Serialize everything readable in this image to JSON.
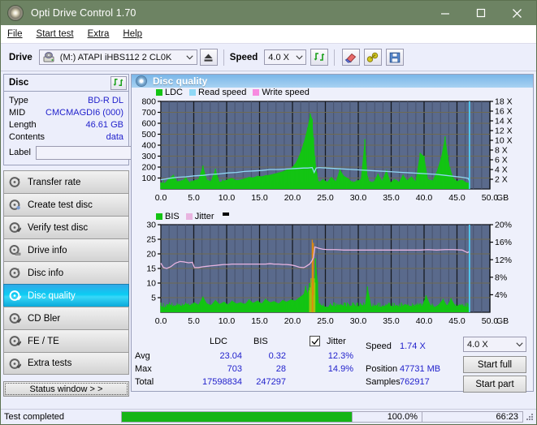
{
  "window": {
    "title": "Opti Drive Control 1.70",
    "icon": "disc-icon",
    "minimize": "minimize-icon",
    "maximize": "maximize-icon",
    "close": "close-icon"
  },
  "menu": {
    "items": [
      {
        "label": "File"
      },
      {
        "label": "Start test"
      },
      {
        "label": "Extra"
      },
      {
        "label": "Help"
      }
    ]
  },
  "toolbar": {
    "drive_label": "Drive",
    "drive_value": "(M:)   ATAPI iHBS112  2 CL0K",
    "eject_icon": "eject-icon",
    "speed_label": "Speed",
    "speed_value": "4.0 X",
    "refresh_icon": "refresh-icon",
    "eraser_icon": "eraser-icon",
    "key_icon": "key-icon",
    "save_icon": "floppy-save-icon"
  },
  "disc": {
    "panel_title": "Disc",
    "refresh_icon": "refresh-icon",
    "rows": [
      {
        "key": "Type",
        "value": "BD-R DL"
      },
      {
        "key": "MID",
        "value": "CMCMAGDI6 (000)"
      },
      {
        "key": "Length",
        "value": "46.61 GB"
      },
      {
        "key": "Contents",
        "value": "data"
      }
    ],
    "label_key": "Label",
    "label_value": "",
    "label_placeholder": "",
    "disc_button_icon": "disc-icon"
  },
  "sidebar": {
    "items": [
      {
        "label": "Transfer rate",
        "icon": "disc-test-icon",
        "selected": false
      },
      {
        "label": "Create test disc",
        "icon": "disc-write-icon",
        "selected": false
      },
      {
        "label": "Verify test disc",
        "icon": "disc-verify-icon",
        "selected": false
      },
      {
        "label": "Drive info",
        "icon": "drive-info-icon",
        "selected": false
      },
      {
        "label": "Disc info",
        "icon": "disc-info-icon",
        "selected": false
      },
      {
        "label": "Disc quality",
        "icon": "disc-quality-icon",
        "selected": true
      },
      {
        "label": "CD Bler",
        "icon": "cd-bler-icon",
        "selected": false
      },
      {
        "label": "FE / TE",
        "icon": "fete-icon",
        "selected": false
      },
      {
        "label": "Extra tests",
        "icon": "extra-tests-icon",
        "selected": false
      }
    ],
    "status_window_button": "Status window > >"
  },
  "content": {
    "header_title": "Disc quality",
    "header_icon": "disc-quality-icon"
  },
  "chart_data": [
    {
      "type": "area",
      "title": "Disc quality - LDC",
      "xlabel": "GB",
      "ylabel": "",
      "xlim": [
        0.0,
        50.0
      ],
      "xticks": [
        "0.0",
        "5.0",
        "10.0",
        "15.0",
        "20.0",
        "25.0",
        "30.0",
        "35.0",
        "40.0",
        "45.0",
        "50.0"
      ],
      "x_unit": "GB",
      "ylim": [
        0,
        800
      ],
      "yticks": [
        100,
        200,
        300,
        400,
        500,
        600,
        700,
        800
      ],
      "y2lim": [
        0,
        18
      ],
      "y2ticks": [
        "2 X",
        "4 X",
        "6 X",
        "8 X",
        "10 X",
        "12 X",
        "14 X",
        "16 X",
        "18 X"
      ],
      "grid": true,
      "legend_position": "top-left",
      "legend": [
        {
          "name": "LDC",
          "color": "#13c413"
        },
        {
          "name": "Read speed",
          "color": "#8fd8f5"
        },
        {
          "name": "Write speed",
          "color": "#f78ae0"
        }
      ],
      "series": [
        {
          "name": "LDC",
          "color": "#13c413",
          "type": "area",
          "x": [
            0.0,
            0.6,
            1.2,
            1.9,
            2.5,
            3.2,
            3.8,
            4.4,
            5.1,
            5.7,
            6.4,
            7.0,
            7.6,
            8.3,
            8.9,
            9.6,
            10.2,
            10.8,
            11.5,
            12.1,
            12.7,
            13.4,
            14.0,
            14.7,
            15.3,
            15.9,
            16.6,
            17.2,
            17.9,
            18.5,
            19.1,
            19.8,
            20.4,
            21.0,
            21.7,
            22.3,
            22.7,
            23.0,
            23.2,
            23.4,
            23.7,
            24.0,
            24.6,
            25.3,
            25.9,
            26.6,
            27.2,
            27.8,
            28.5,
            29.1,
            29.8,
            30.4,
            31.0,
            31.4,
            31.7,
            32.3,
            33.0,
            33.6,
            34.3,
            34.9,
            35.5,
            36.2,
            36.8,
            37.4,
            38.1,
            38.7,
            39.4,
            40.0,
            40.6,
            41.3,
            41.9,
            42.6,
            43.2,
            43.6,
            43.9,
            44.5,
            45.1,
            45.8,
            46.4,
            46.9
          ],
          "y": [
            60,
            55,
            95,
            130,
            70,
            75,
            105,
            60,
            80,
            90,
            215,
            85,
            70,
            185,
            65,
            75,
            90,
            100,
            80,
            85,
            95,
            110,
            105,
            120,
            115,
            125,
            130,
            140,
            150,
            160,
            175,
            190,
            230,
            300,
            420,
            560,
            690,
            640,
            470,
            300,
            150,
            60,
            90,
            65,
            110,
            70,
            180,
            120,
            95,
            60,
            75,
            90,
            455,
            120,
            70,
            60,
            140,
            75,
            175,
            60,
            90,
            65,
            130,
            80,
            115,
            70,
            330,
            300,
            90,
            75,
            155,
            290,
            480,
            310,
            200,
            95,
            70,
            85,
            60,
            55
          ]
        },
        {
          "name": "Read speed",
          "color": "#8fd8f5",
          "type": "line",
          "x": [
            0.0,
            1.3,
            2.5,
            3.8,
            5.1,
            6.4,
            7.6,
            8.9,
            10.2,
            11.5,
            12.7,
            14.0,
            15.3,
            16.6,
            17.9,
            19.1,
            20.4,
            21.7,
            22.3,
            23.0,
            23.3,
            23.6,
            24.0,
            25.3,
            26.6,
            27.8,
            29.1,
            30.4,
            31.7,
            33.0,
            34.3,
            35.5,
            36.8,
            38.1,
            39.4,
            40.6,
            41.9,
            43.2,
            44.5,
            45.8,
            46.7,
            46.9
          ],
          "y_speed": [
            1.9,
            2.2,
            2.4,
            2.5,
            2.7,
            2.8,
            3.0,
            3.1,
            3.3,
            3.4,
            3.6,
            3.7,
            3.8,
            4.0,
            4.0,
            4.1,
            4.2,
            4.3,
            4.3,
            4.4,
            3.4,
            4.3,
            4.4,
            4.3,
            4.2,
            4.1,
            4.0,
            3.9,
            3.8,
            3.7,
            3.6,
            3.5,
            3.4,
            3.3,
            3.2,
            3.1,
            3.0,
            2.8,
            2.6,
            2.4,
            2.2,
            1.6
          ]
        },
        {
          "name": "Write speed",
          "color": "#f78ae0",
          "type": "line",
          "x": [],
          "y": []
        }
      ],
      "markers": [
        {
          "name": "end-of-data-cursor",
          "x": 46.9,
          "color": "#4fd8ff"
        }
      ]
    },
    {
      "type": "area",
      "title": "Disc quality - BIS / Jitter",
      "xlabel": "GB",
      "ylabel": "",
      "xlim": [
        0.0,
        50.0
      ],
      "xticks": [
        "0.0",
        "5.0",
        "10.0",
        "15.0",
        "20.0",
        "25.0",
        "30.0",
        "35.0",
        "40.0",
        "45.0",
        "50.0"
      ],
      "x_unit": "GB",
      "ylim": [
        0,
        30
      ],
      "yticks": [
        5,
        10,
        15,
        20,
        25,
        30
      ],
      "y2lim": [
        0,
        20
      ],
      "y2ticks": [
        "4%",
        "8%",
        "12%",
        "16%",
        "20%"
      ],
      "grid": true,
      "legend_position": "top-left",
      "legend": [
        {
          "name": "BIS",
          "color": "#13c413"
        },
        {
          "name": "Jitter",
          "color": "#e8b4e0"
        },
        {
          "name": "marker",
          "color": "#000000"
        }
      ],
      "series": [
        {
          "name": "BIS",
          "color": "#13c413",
          "type": "area",
          "x": [
            0.0,
            0.6,
            1.3,
            1.9,
            2.5,
            3.2,
            3.8,
            4.5,
            5.1,
            5.7,
            6.4,
            7.0,
            7.6,
            8.3,
            8.9,
            9.6,
            10.2,
            10.8,
            11.5,
            12.1,
            12.8,
            13.4,
            14.0,
            14.7,
            15.3,
            15.9,
            16.6,
            17.2,
            17.9,
            18.5,
            19.1,
            19.8,
            20.4,
            21.0,
            21.7,
            22.0,
            22.3,
            22.6,
            22.9,
            23.1,
            23.3,
            23.5,
            23.8,
            24.0,
            24.6,
            25.3,
            25.9,
            26.6,
            27.2,
            27.8,
            28.5,
            29.1,
            29.8,
            30.4,
            31.0,
            31.4,
            32.0,
            32.6,
            33.3,
            33.9,
            34.6,
            35.2,
            35.8,
            36.5,
            37.1,
            37.8,
            38.4,
            39.0,
            39.7,
            40.3,
            41.0,
            41.6,
            42.2,
            42.9,
            43.5,
            44.1,
            44.8,
            45.4,
            46.0,
            46.6,
            46.9
          ],
          "y": [
            2.2,
            1.6,
            2.8,
            2.0,
            2.6,
            2.2,
            3.0,
            2.4,
            3.4,
            2.6,
            5.4,
            3.0,
            2.4,
            4.2,
            2.8,
            3.6,
            2.6,
            4.0,
            3.0,
            3.4,
            2.8,
            4.4,
            3.2,
            4.0,
            3.0,
            4.6,
            3.4,
            3.8,
            3.0,
            4.2,
            3.6,
            4.4,
            4.0,
            5.0,
            6.2,
            9.0,
            6.5,
            10.0,
            7.5,
            15.0,
            9.5,
            18.5,
            11.0,
            3.0,
            2.2,
            1.8,
            2.4,
            2.0,
            2.6,
            2.2,
            2.0,
            2.4,
            1.8,
            2.6,
            2.2,
            8.8,
            2.0,
            2.4,
            1.8,
            2.2,
            2.6,
            2.0,
            2.4,
            1.8,
            2.8,
            2.2,
            2.0,
            2.6,
            2.2,
            5.8,
            2.4,
            1.8,
            2.6,
            4.6,
            2.2,
            4.8,
            2.0,
            2.6,
            2.2,
            1.8,
            1.6
          ]
        },
        {
          "name": "Jitter",
          "color": "#e8b4e0",
          "type": "line",
          "x": [
            0.0,
            0.4,
            0.9,
            1.5,
            2.2,
            2.9,
            3.5,
            4.2,
            4.8,
            5.1,
            5.7,
            6.4,
            7.0,
            7.6,
            8.3,
            8.9,
            9.6,
            10.2,
            10.8,
            11.5,
            12.1,
            12.8,
            13.4,
            14.0,
            14.7,
            15.3,
            15.9,
            16.6,
            17.2,
            17.9,
            18.5,
            19.1,
            19.8,
            20.4,
            21.0,
            21.7,
            22.0,
            22.6,
            22.9,
            23.2,
            23.4,
            24.0,
            24.6,
            25.3,
            26.6,
            27.8,
            29.1,
            30.4,
            31.7,
            33.0,
            34.3,
            35.5,
            36.8,
            38.1,
            39.4,
            40.6,
            41.9,
            43.2,
            44.5,
            45.8,
            46.6,
            46.9
          ],
          "y_pct": [
            11.2,
            10.2,
            10.0,
            10.4,
            11.2,
            11.6,
            11.5,
            11.3,
            11.4,
            10.2,
            10.2,
            10.4,
            10.5,
            10.6,
            10.7,
            10.8,
            10.9,
            10.9,
            11.0,
            11.0,
            11.0,
            11.0,
            11.0,
            11.0,
            11.0,
            11.0,
            11.0,
            11.1,
            11.0,
            11.0,
            10.9,
            10.9,
            10.8,
            10.6,
            10.3,
            10.2,
            10.4,
            11.0,
            11.6,
            12.5,
            14.9,
            14.6,
            14.4,
            14.3,
            14.3,
            14.2,
            14.2,
            14.2,
            14.2,
            14.2,
            14.2,
            14.2,
            14.2,
            14.2,
            14.2,
            14.3,
            14.2,
            14.3,
            14.3,
            14.2,
            13.6,
            13.9
          ]
        }
      ],
      "markers": [
        {
          "name": "end-of-data-cursor",
          "x": 46.9,
          "color": "#4fd8ff"
        }
      ]
    }
  ],
  "stats": {
    "col_headers": {
      "ldc": "LDC",
      "bis": "BIS",
      "jitter": "Jitter"
    },
    "rows": [
      {
        "label": "Avg",
        "ldc": "23.04",
        "bis": "0.32",
        "jitter": "12.3%"
      },
      {
        "label": "Max",
        "ldc": "703",
        "bis": "28",
        "jitter": "14.9%"
      },
      {
        "label": "Total",
        "ldc": "17598834",
        "bis": "247297",
        "jitter": ""
      }
    ],
    "jitter_checked": true,
    "speed_label": "Speed",
    "speed_value": "1.74 X",
    "position_label": "Position",
    "position_value": "47731 MB",
    "samples_label": "Samples",
    "samples_value": "762917",
    "speed_select": "4.0 X",
    "start_full": "Start full",
    "start_part": "Start part"
  },
  "statusbar": {
    "text": "Test completed",
    "progress": "100.0%",
    "progress_pct": 100,
    "elapsed": "66:23"
  }
}
